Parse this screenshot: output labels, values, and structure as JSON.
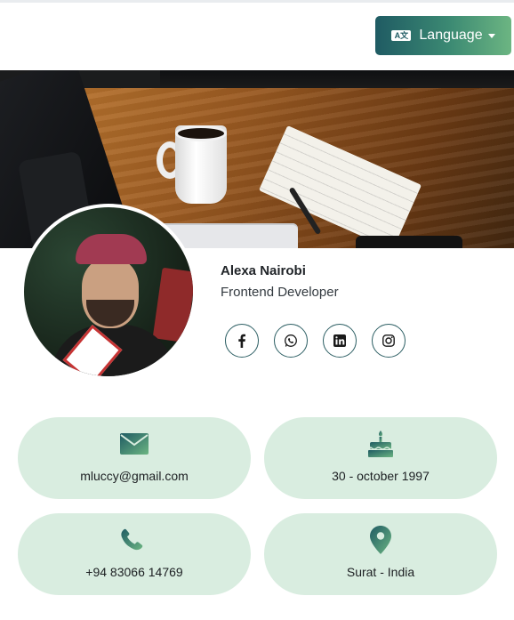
{
  "header": {
    "language_button": {
      "label": "Language",
      "icon": "translate-icon",
      "icon_text": "A文"
    }
  },
  "profile": {
    "name": "Alexa Nairobi",
    "title": "Frontend Developer",
    "socials": [
      {
        "icon": "facebook-icon"
      },
      {
        "icon": "whatsapp-icon"
      },
      {
        "icon": "linkedin-icon"
      },
      {
        "icon": "instagram-icon"
      }
    ]
  },
  "info": {
    "email": {
      "icon": "envelope-icon",
      "value": "mluccy@gmail.com"
    },
    "birthday": {
      "icon": "cake-icon",
      "value": "30 - october 1997"
    },
    "phone": {
      "icon": "phone-icon",
      "value": "+94 83066 14769"
    },
    "location": {
      "icon": "location-pin-icon",
      "value": "Surat - India"
    }
  },
  "colors": {
    "accent_dark": "#1f5b63",
    "accent_light": "#6cb582",
    "card_bg": "#d9ede0"
  }
}
